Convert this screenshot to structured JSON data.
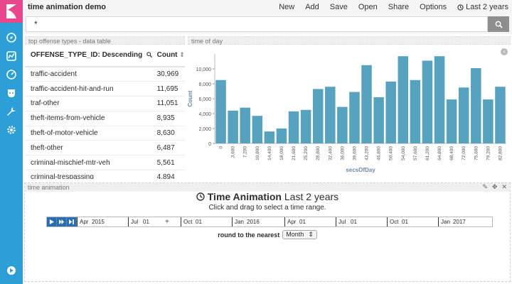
{
  "app": {
    "title": "time animation demo"
  },
  "menu": {
    "new": "New",
    "add": "Add",
    "save": "Save",
    "open": "Open",
    "share": "Share",
    "options": "Options",
    "time": "Last 2 years"
  },
  "search": {
    "value": "*"
  },
  "table_panel": {
    "title": "top offense types - data table",
    "col1": "OFFENSE_TYPE_ID: Descending",
    "col2": "Count",
    "rows": [
      {
        "name": "traffic-accident",
        "count": "30,969"
      },
      {
        "name": "traffic-accident-hit-and-run",
        "count": "11,695"
      },
      {
        "name": "traf-other",
        "count": "11,051"
      },
      {
        "name": "theft-items-from-vehicle",
        "count": "8,935"
      },
      {
        "name": "theft-of-motor-vehicle",
        "count": "8,630"
      },
      {
        "name": "theft-other",
        "count": "6,487"
      },
      {
        "name": "criminal-mischief-mtr-veh",
        "count": "5,561"
      },
      {
        "name": "criminal-trespassing",
        "count": "4,894"
      }
    ]
  },
  "chart_panel": {
    "title": "time of day"
  },
  "chart_data": {
    "type": "bar",
    "xlabel": "secsOfDay",
    "ylabel": "Count",
    "ylim": [
      0,
      12000
    ],
    "yticks": [
      "0",
      "2,000",
      "4,000",
      "6,000",
      "8,000",
      "10,000"
    ],
    "categories": [
      "0",
      "3,600",
      "7,200",
      "10,800",
      "14,400",
      "18,000",
      "21,600",
      "25,200",
      "28,800",
      "32,400",
      "36,000",
      "39,600",
      "43,200",
      "46,800",
      "50,400",
      "54,000",
      "57,600",
      "61,200",
      "64,800",
      "68,400",
      "72,000",
      "75,600",
      "79,200",
      "82,800"
    ],
    "values": [
      8500,
      4400,
      4800,
      3700,
      1600,
      2000,
      4300,
      4500,
      7300,
      7600,
      4900,
      6900,
      10500,
      6200,
      8300,
      11700,
      8500,
      11100,
      11700,
      5900,
      7500,
      10100,
      5900,
      7600
    ],
    "color": "#57a3bf"
  },
  "anim_panel": {
    "header": "time animation",
    "title": "Time Animation",
    "range": "Last 2 years",
    "subtitle": "Click and drag to select a time range.",
    "round_label": "round to the nearest",
    "round_value": "Month",
    "ticks": [
      "Apr",
      "2015",
      "Jul",
      "01",
      "Oct",
      "01",
      "Jan",
      "2016",
      "Apr",
      "01",
      "Jul",
      "01",
      "Oct",
      "01",
      "Jan",
      "2017"
    ]
  }
}
